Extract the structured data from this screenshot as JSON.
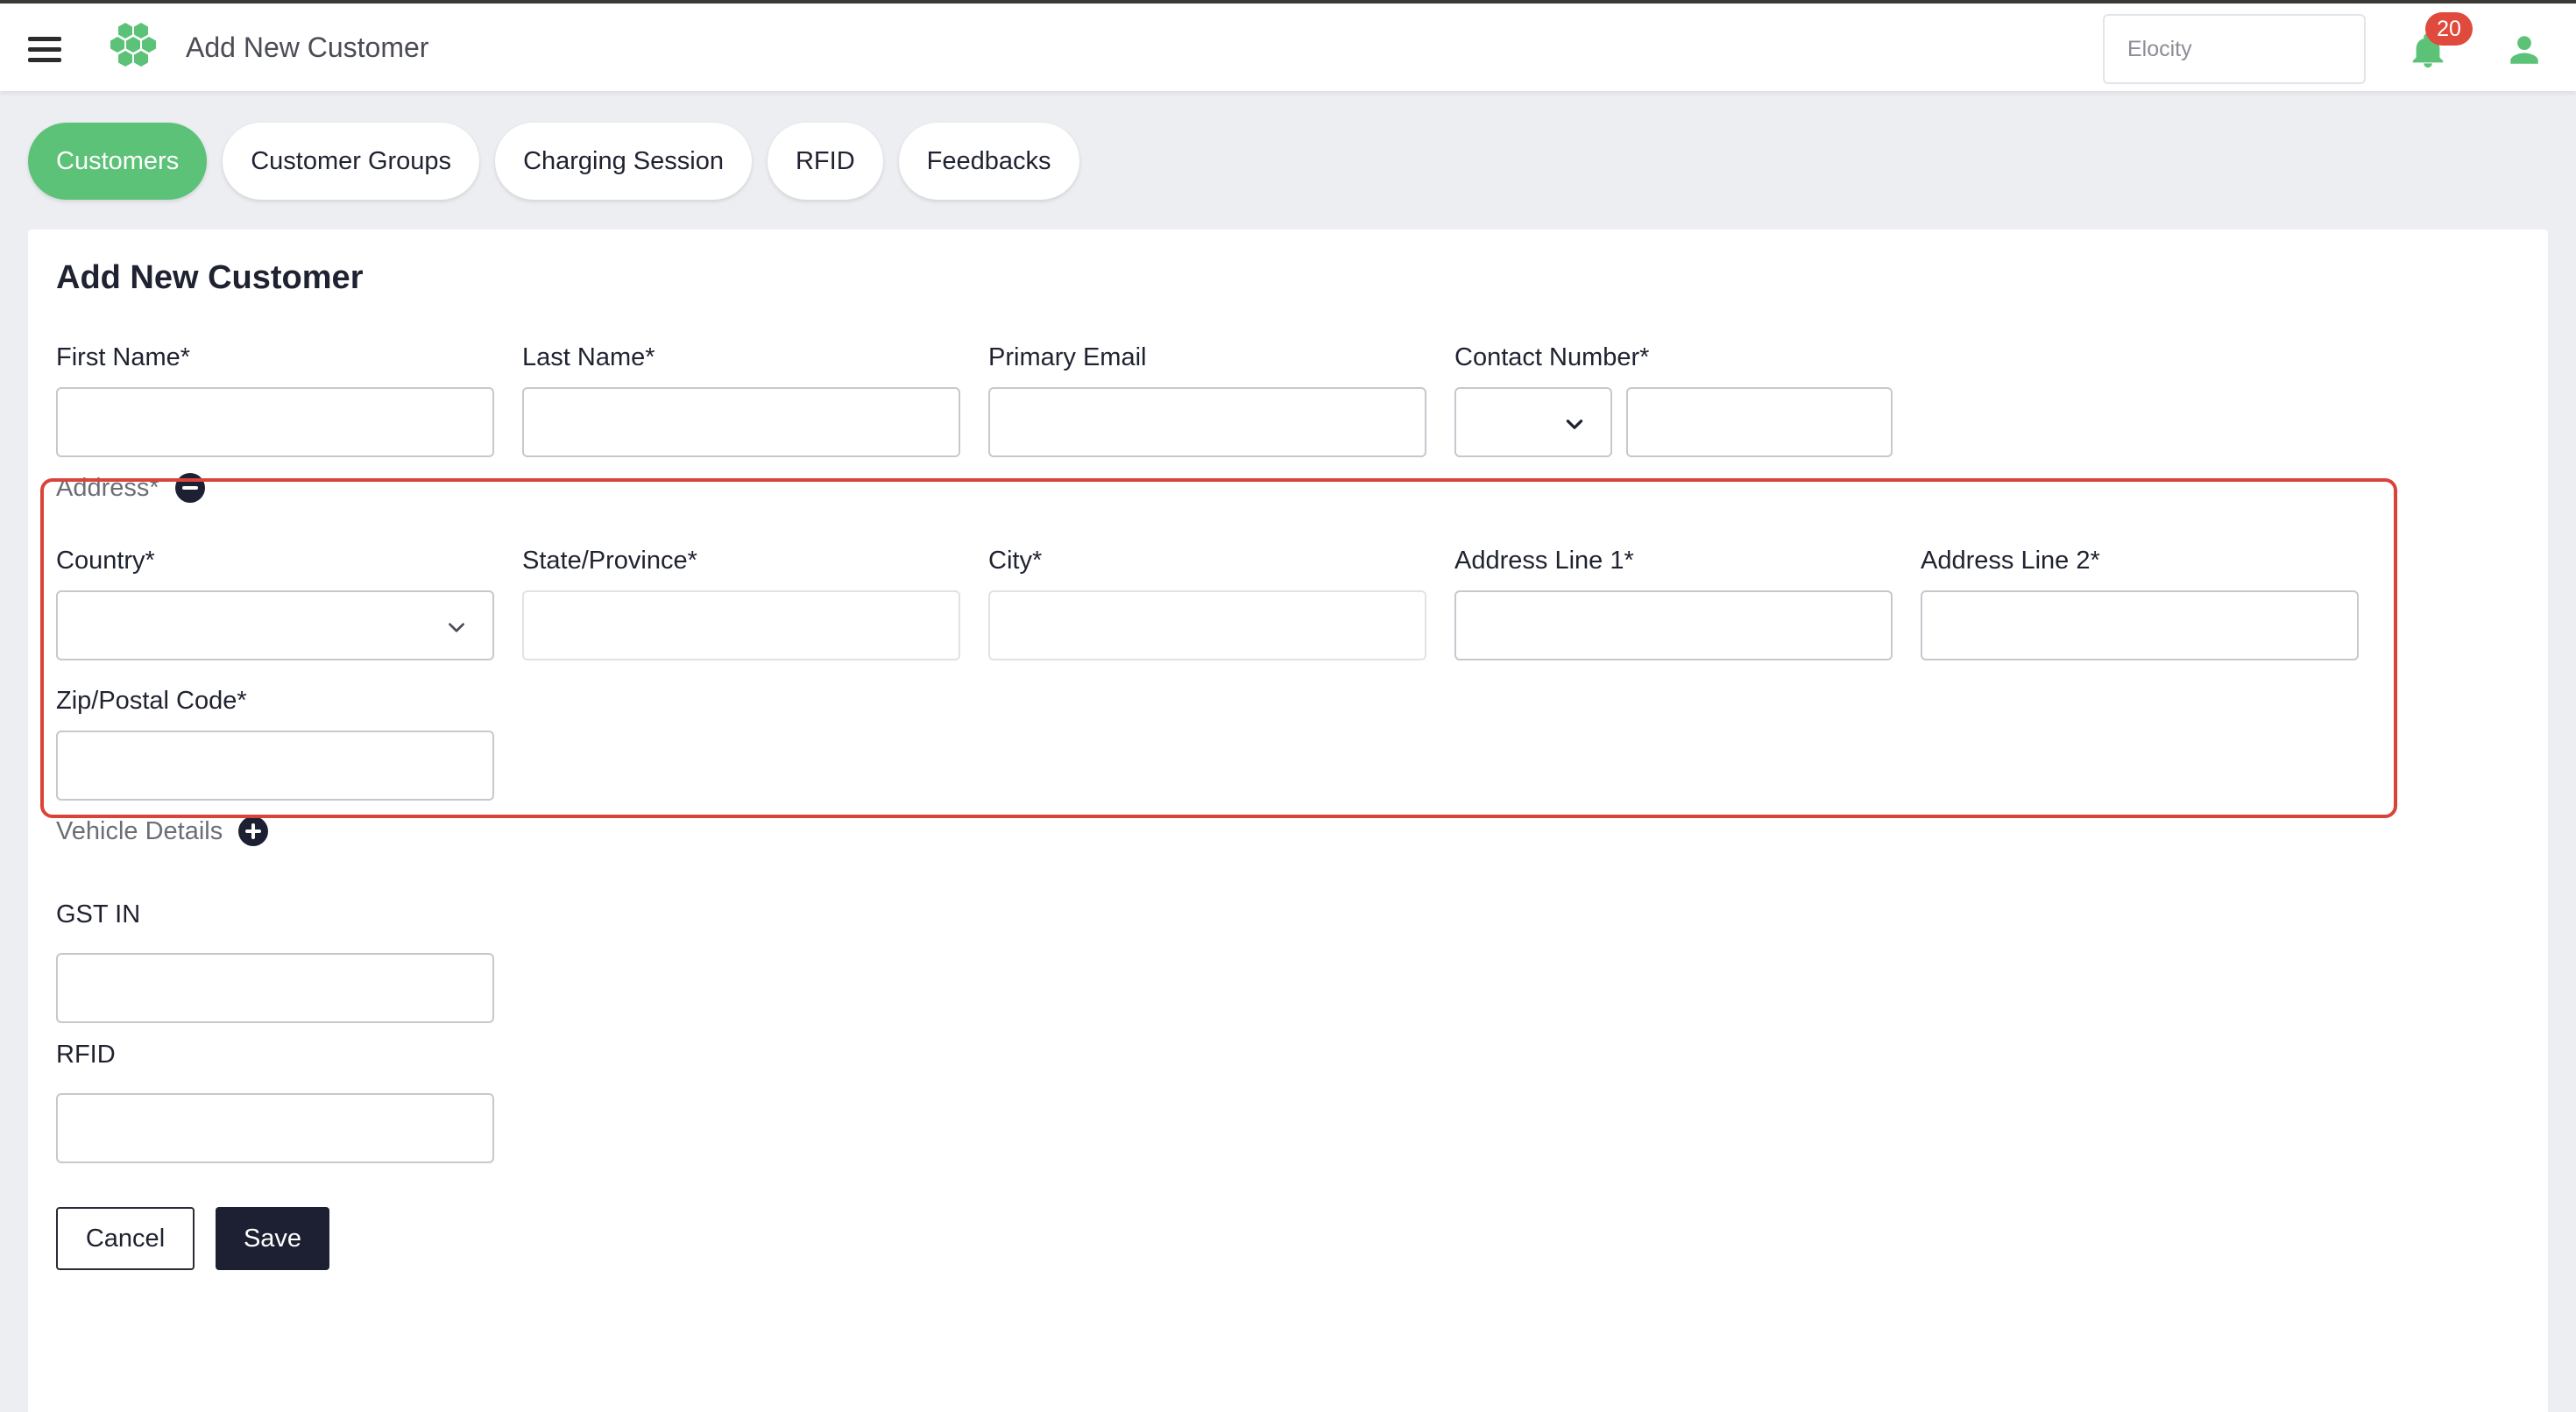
{
  "header": {
    "title": "Add New Customer",
    "search_placeholder": "Elocity",
    "notification_count": "20",
    "accent_color": "#5cc277"
  },
  "tabs": [
    {
      "label": "Customers",
      "active": true
    },
    {
      "label": "Customer Groups",
      "active": false
    },
    {
      "label": "Charging Session",
      "active": false
    },
    {
      "label": "RFID",
      "active": false
    },
    {
      "label": "Feedbacks",
      "active": false
    }
  ],
  "form": {
    "title": "Add New Customer",
    "first_name_label": "First Name*",
    "last_name_label": "Last Name*",
    "primary_email_label": "Primary Email",
    "contact_number_label": "Contact Number*",
    "address_section_label": "Address*",
    "country_label": "Country*",
    "state_label": "State/Province*",
    "city_label": "City*",
    "address_line1_label": "Address Line 1*",
    "address_line2_label": "Address Line 2*",
    "zip_label": "Zip/Postal Code*",
    "vehicle_section_label": "Vehicle Details",
    "gst_label": "GST IN",
    "rfid_label": "RFID",
    "cancel_label": "Cancel",
    "save_label": "Save"
  },
  "icons": {
    "menu": "hamburger-menu-icon",
    "logo": "hexagon-cluster-logo",
    "bell": "bell-icon",
    "user": "user-icon",
    "address_toggle": "minus-circle-icon",
    "vehicle_toggle": "plus-circle-icon",
    "dropdown": "chevron-down-icon"
  },
  "colors": {
    "primary_dark": "#1d2033",
    "highlight": "#d9443a",
    "badge": "#e04a3c"
  }
}
